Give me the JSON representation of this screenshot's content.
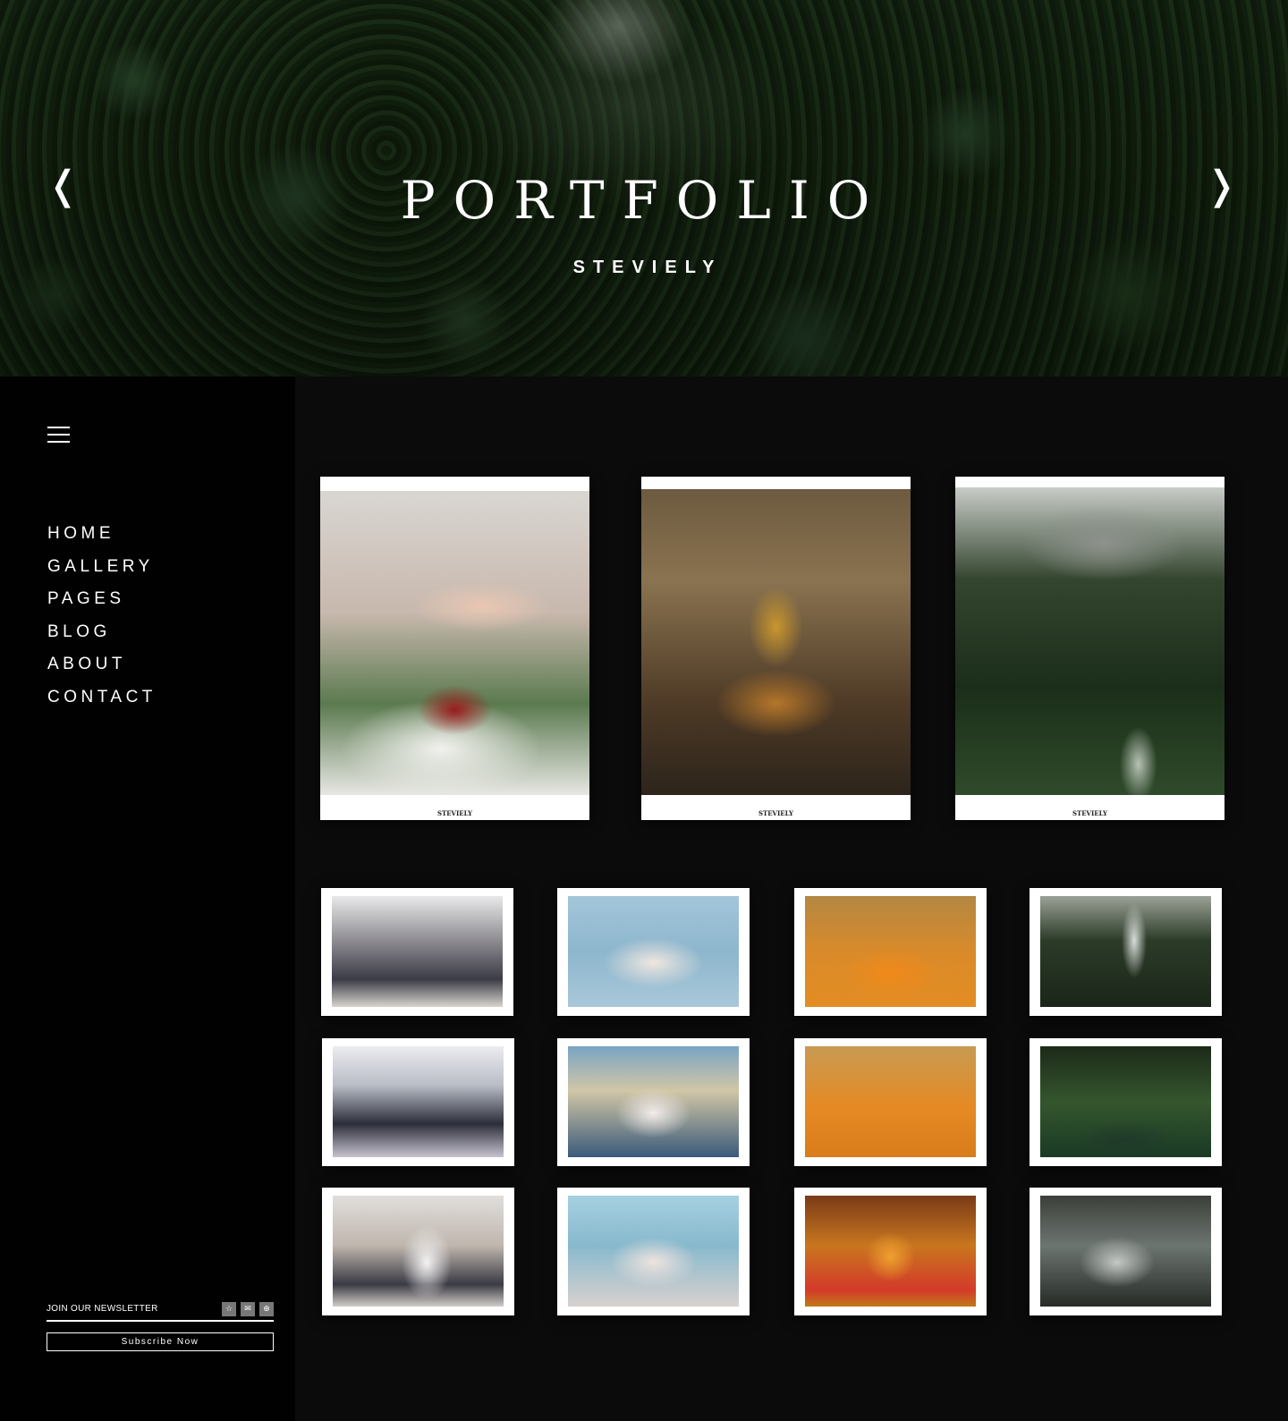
{
  "hero": {
    "title": "PORTFOLIO",
    "subtitle": "STEVIELY",
    "prev_icon": "chevron-left-icon",
    "next_icon": "chevron-right-icon",
    "prev_glyph": "❬",
    "next_glyph": "❭"
  },
  "sidebar": {
    "menu_icon": "hamburger-menu-icon",
    "nav": [
      "HOME",
      "GALLERY",
      "PAGES",
      "BLOG",
      "ABOUT",
      "CONTACT"
    ],
    "newsletter": {
      "label": "JOIN OUR NEWSLETTER",
      "icons": [
        {
          "name": "star-icon",
          "glyph": "☆"
        },
        {
          "name": "mail-icon",
          "glyph": "✉"
        },
        {
          "name": "globe-icon",
          "glyph": "⊕"
        }
      ],
      "button": "Subscribe Now"
    }
  },
  "gallery": {
    "featured": [
      {
        "caption": "STEVIELY",
        "photo": "wedding-hands"
      },
      {
        "caption": "STEVIELY",
        "photo": "buddha-shrine"
      },
      {
        "caption": "STEVIELY",
        "photo": "misty-forest"
      }
    ],
    "thumbnails": [
      "wedding-procession",
      "bridal-party-blue",
      "monks-ceremony",
      "waterfall",
      "group-photo",
      "couple-family",
      "monks-seated",
      "forest-pool",
      "bride-groom-arch",
      "family-portrait",
      "temple-monk",
      "man-on-rocks"
    ]
  },
  "colors": {
    "background": "#0b0b0b",
    "sidebar": "#010101",
    "text": "#ffffff"
  }
}
